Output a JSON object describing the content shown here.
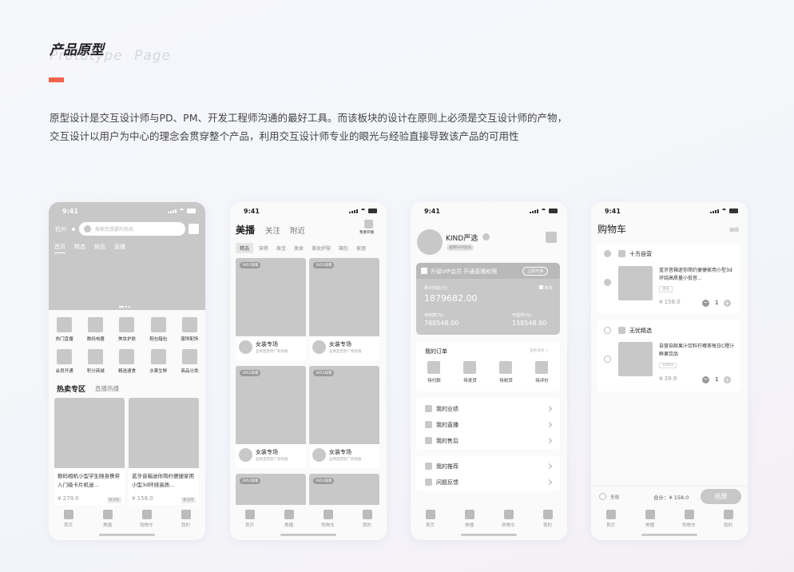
{
  "header": {
    "title": "产品原型",
    "subtitle": "Prototype Page",
    "desc": [
      "原型设计是交互设计师与PD、PM、开发工程师沟通的最好工具。而该板块的设计在原则上必须是交互设计师的产物，",
      "交互设计以用户为中心的理念会贯穿整个产品，利用交互设计师专业的眼光与经验直接导致该产品的可用性"
    ]
  },
  "status": {
    "time": "9:41"
  },
  "home": {
    "city": "杭州",
    "search_placeholder": "搜索您想要的商品",
    "tabs": [
      "首页",
      "精选",
      "新品",
      "直播"
    ],
    "categories": [
      "热门直播",
      "数码电器",
      "美妆护肤",
      "鞋包箱包",
      "服饰配饰",
      "会员开通",
      "积分商城",
      "精选速食",
      "水果生鲜",
      "商品分类"
    ],
    "section_tabs": [
      "热卖专区",
      "直播热播"
    ],
    "products": [
      {
        "title": "数码相机小型学生随身携带入门级卡片机迷...",
        "price": "¥ 279.0",
        "tag": "看详情"
      },
      {
        "title": "蓝牙音箱迷你简约便捷家用小型3d环绕高质...",
        "price": "¥ 158.0",
        "tag": "看详情"
      }
    ],
    "tabbar": [
      "首页",
      "美播",
      "购物车",
      "我的"
    ]
  },
  "feed": {
    "tabs": [
      "美播",
      "关注",
      "附近"
    ],
    "publish_label": "我要开播",
    "filters": [
      "精选",
      "穿搭",
      "珠宝",
      "美食",
      "美妆护肤",
      "箱包",
      "家居"
    ],
    "views": "3952观看",
    "card_title": "女装专场",
    "card_sub": "品牌直营原厂新款服",
    "tabbar": [
      "首页",
      "美播",
      "购物车",
      "我的"
    ]
  },
  "profile": {
    "name": "KIND严选",
    "badge": "金牌SVIP会员",
    "vip_text": "升级VIP会员 开通直播权限",
    "vip_btn": "立即开通",
    "earn_label": "累计收益(元)",
    "earn_value": "1879682.00",
    "bill_label": "账单",
    "pending_label": "待结算(元)",
    "pending_value": "768548.00",
    "withdraw_label": "可提现(元)",
    "withdraw_value": "158548.60",
    "orders_title": "我的订单",
    "orders_link": "查看详情 >",
    "order_items": [
      "待付款",
      "待发货",
      "待收货",
      "待评价"
    ],
    "menu1": [
      "我的业绩",
      "我的直播",
      "我的售后"
    ],
    "menu2": [
      "我的推荐",
      "问题反馈"
    ],
    "tabbar": [
      "首页",
      "美播",
      "购物车",
      "我的"
    ]
  },
  "cart": {
    "title": "购物车",
    "edit": "编辑",
    "stores": [
      {
        "name": "十方自营",
        "item": "蓝牙音箱迷你简约便捷家用小型3d环绕高质量小低音...",
        "spec": "黑色",
        "price": "¥ 158.0",
        "qty": "1"
      },
      {
        "name": "无忧精选",
        "item": "自营自邮果汁饮料柠檬茶每日C橙汁鲜果饮品",
        "spec": "330ml",
        "price": "¥ 39.9",
        "qty": "1"
      }
    ],
    "select_all": "全选",
    "total": "合计：¥ 158.0",
    "checkout": "结算",
    "tabbar": [
      "首页",
      "美播",
      "购物车",
      "我的"
    ]
  }
}
